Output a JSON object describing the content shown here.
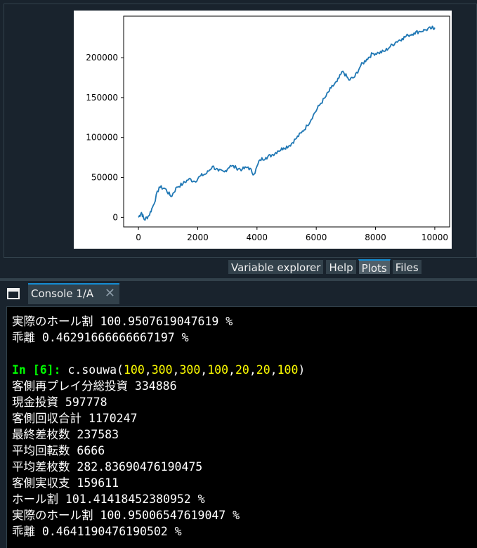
{
  "chart_data": {
    "type": "line",
    "xticks": [
      "0",
      "2000",
      "4000",
      "6000",
      "8000",
      "10000"
    ],
    "yticks": [
      "0",
      "50000",
      "100000",
      "150000",
      "200000"
    ],
    "xlim": [
      -500,
      10500
    ],
    "ylim": [
      -12000,
      252000
    ],
    "series": [
      {
        "color": "#1f77b4",
        "x": [
          0,
          100,
          200,
          350,
          500,
          700,
          900,
          1100,
          1300,
          1500,
          1700,
          1900,
          2100,
          2300,
          2500,
          2700,
          2900,
          3100,
          3300,
          3500,
          3700,
          3900,
          4100,
          4300,
          4500,
          4700,
          4900,
          5100,
          5300,
          5500,
          5700,
          5900,
          6100,
          6300,
          6500,
          6700,
          6900,
          7100,
          7300,
          7500,
          7700,
          7900,
          8100,
          8300,
          8500,
          8700,
          8900,
          9100,
          9300,
          9500,
          9700,
          9900,
          10000
        ],
        "y": [
          0,
          6000,
          -3000,
          2000,
          15000,
          38000,
          36000,
          26000,
          38000,
          42000,
          48000,
          45000,
          52000,
          55000,
          64000,
          58000,
          57000,
          65000,
          62000,
          60000,
          63000,
          54000,
          72000,
          75000,
          78000,
          83000,
          87000,
          90000,
          98000,
          106000,
          115000,
          128000,
          140000,
          150000,
          162000,
          170000,
          183000,
          172000,
          176000,
          190000,
          198000,
          205000,
          206000,
          208000,
          214000,
          220000,
          224000,
          228000,
          231000,
          233000,
          235000,
          237000,
          237583
        ]
      }
    ]
  },
  "tabs": {
    "variable_explorer": "Variable explorer",
    "help": "Help",
    "plots": "Plots",
    "files": "Files"
  },
  "console": {
    "tab_label": "Console 1/A",
    "close_glyph": "✕",
    "lines": {
      "l0_label": "実際のホール割 ",
      "l0_value": "100.9507619047619 %",
      "l1_label": "乖離 ",
      "l1_value": "0.46291666666667197 %",
      "prompt": "In [6]: ",
      "call_name": "c.souwa(",
      "args": [
        "100",
        "300",
        "300",
        "100",
        "20",
        "20",
        "100"
      ],
      "call_close": ")",
      "out": [
        "客側再プレイ分総投資 334886",
        "現金投資 597778",
        "客側回収合計 1170247",
        "最終差枚数 237583",
        "平均回転数 6666",
        "平均差枚数 282.83690476190475",
        "客側実収支 159611",
        "ホール割 101.41418452380952 %",
        "実際のホール割 100.95006547619047 %",
        "乖離 0.4641190476190502 %"
      ]
    }
  }
}
